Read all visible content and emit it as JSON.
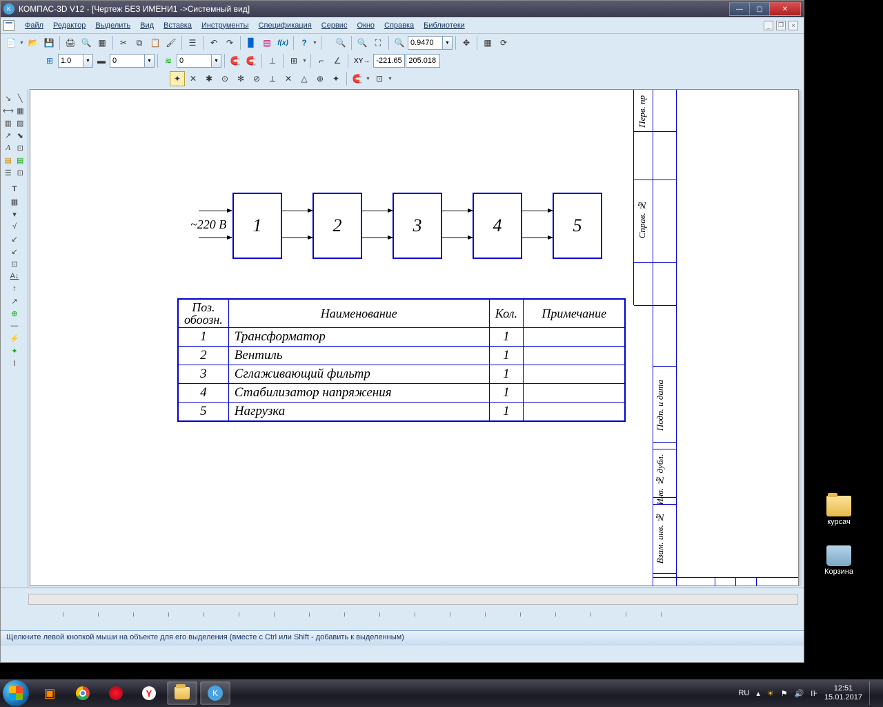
{
  "title": "КОМПАС-3D V12 - [Чертеж БЕЗ ИМЕНИ1 ->Системный вид]",
  "menu": {
    "file": "Файл",
    "editor": "Редактор",
    "select": "Выделить",
    "view": "Вид",
    "insert": "Вставка",
    "tools": "Инструменты",
    "spec": "Спецификация",
    "service": "Сервис",
    "window": "Окно",
    "help": "Справка",
    "libs": "Библиотеки"
  },
  "toolbar1": {
    "zoom_value": "0.9470"
  },
  "toolbar2": {
    "step1": "1.0",
    "step2": "0",
    "step3": "0",
    "coord_label": "XY→",
    "coord_x": "-221.65",
    "coord_y": "205.018"
  },
  "drawing": {
    "voltage": "~220 В",
    "blocks": [
      "1",
      "2",
      "3",
      "4",
      "5"
    ],
    "table": {
      "headers": {
        "pos": "Поз.\nобоозн.",
        "name": "Наименование",
        "qty": "Кол.",
        "note": "Примечание"
      },
      "rows": [
        {
          "pos": "1",
          "name": "Трансформатор",
          "qty": "1",
          "note": ""
        },
        {
          "pos": "2",
          "name": "Вентиль",
          "qty": "1",
          "note": ""
        },
        {
          "pos": "3",
          "name": "Сглаживающий фильтр",
          "qty": "1",
          "note": ""
        },
        {
          "pos": "4",
          "name": "Стабилизатор напряжения",
          "qty": "1",
          "note": ""
        },
        {
          "pos": "5",
          "name": "Нагрузка",
          "qty": "1",
          "note": ""
        }
      ]
    },
    "side_labels": {
      "perv": "Перв. пр",
      "sprav": "Справ. №",
      "podp": "Подп. и дата",
      "inv_dubl": "Инв. № дубл.",
      "vzam": "Взам. инв. №"
    }
  },
  "status": "Щелкните левой кнопкой мыши на объекте для его выделения (вместе с Ctrl или Shift - добавить к выделенным)",
  "tray": {
    "lang": "RU",
    "time": "12:51",
    "date": "15.01.2017"
  },
  "desktop": {
    "folder": "курсач",
    "bin": "Корзина"
  }
}
